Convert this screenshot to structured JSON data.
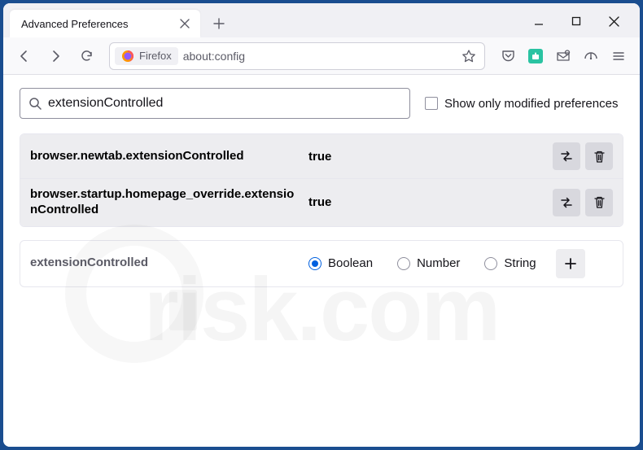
{
  "tab": {
    "title": "Advanced Preferences"
  },
  "urlbar": {
    "identity_label": "Firefox",
    "address": "about:config"
  },
  "search": {
    "value": "extensionControlled",
    "checkbox_label": "Show only modified preferences"
  },
  "prefs": [
    {
      "name": "browser.newtab.extensionControlled",
      "value": "true"
    },
    {
      "name": "browser.startup.homepage_override.extensionControlled",
      "value": "true"
    }
  ],
  "add": {
    "name": "extensionControlled",
    "types": [
      "Boolean",
      "Number",
      "String"
    ],
    "selected": "Boolean"
  },
  "watermark": "risk.com"
}
